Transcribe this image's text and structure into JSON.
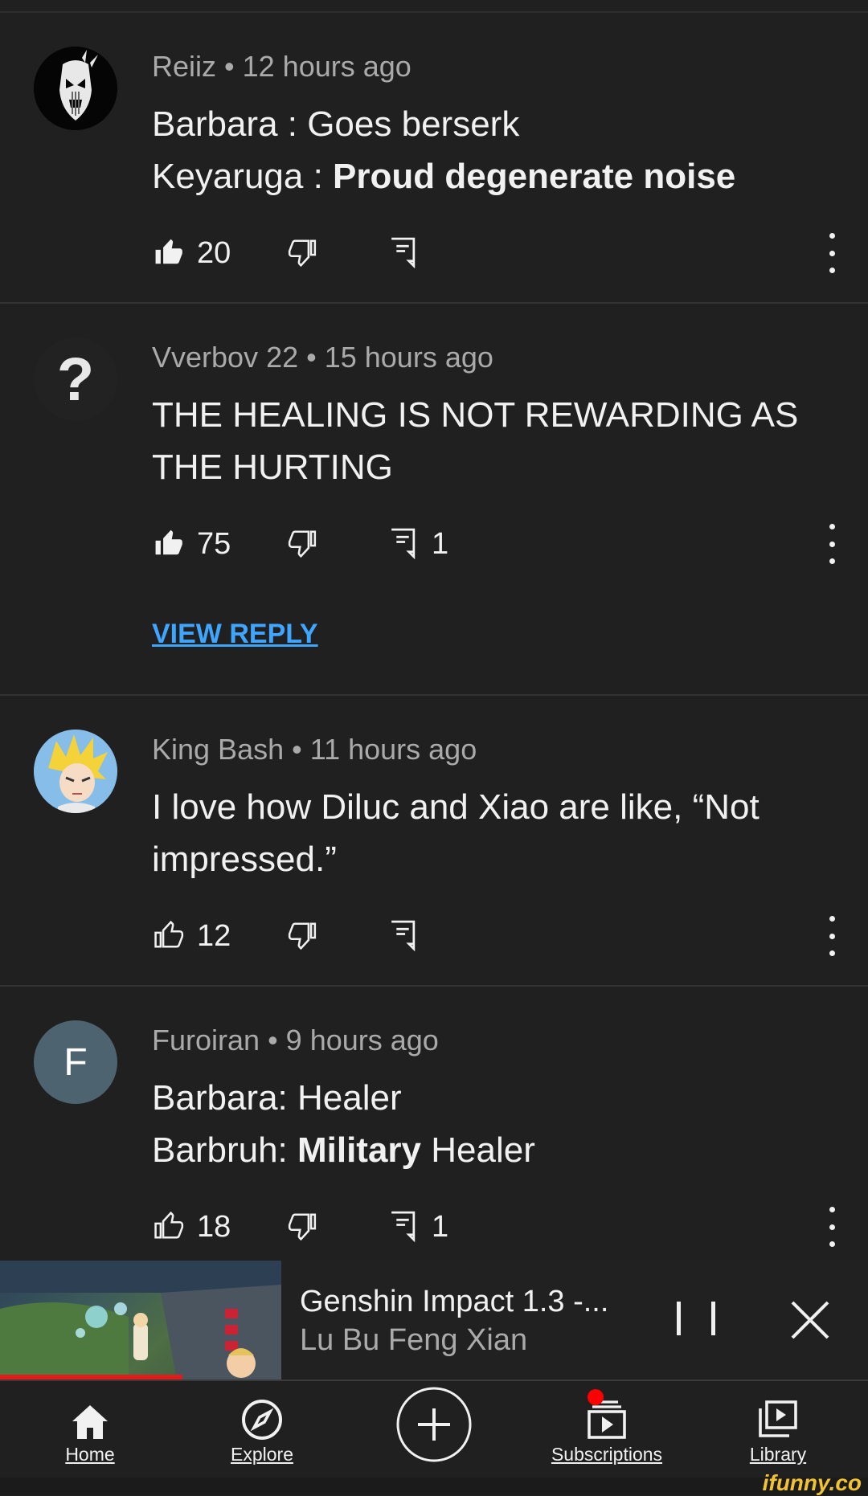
{
  "comments": [
    {
      "author": "Reiiz",
      "time": "12 hours ago",
      "lines": [
        {
          "normal": "Barbara : Goes berserk",
          "bold": "",
          "after": ""
        },
        {
          "normal": "Keyaruga : ",
          "bold": "Proud degenerate noise",
          "after": ""
        }
      ],
      "likes": "20",
      "replies": "",
      "liked": true,
      "avatar": "mask-avatar"
    },
    {
      "author": "Vverbov 22",
      "time": "15 hours ago",
      "text": "THE HEALING IS NOT REWARDING AS THE HURTING",
      "likes": "75",
      "replies": "1",
      "liked": true,
      "view_reply": "VIEW REPLY",
      "avatar_text": "?"
    },
    {
      "author": "King Bash",
      "time": "11 hours ago",
      "text": "I love how Diluc and Xiao are like, “Not impressed.”",
      "likes": "12",
      "replies": "",
      "liked": false,
      "avatar": "anime-character-avatar"
    },
    {
      "author": "Furoiran",
      "time": "9 hours ago",
      "lines": [
        {
          "normal": "Barbara: Healer",
          "bold": "",
          "after": ""
        },
        {
          "normal": "Barbruh: ",
          "bold": "Military",
          "after": " Healer"
        }
      ],
      "likes": "18",
      "replies": "1",
      "liked": false,
      "avatar_text": "F"
    }
  ],
  "separator": " • ",
  "miniplayer": {
    "title": "Genshin Impact 1.3 -...",
    "channel": "Lu Bu Feng Xian",
    "progress": 0.21
  },
  "nav": {
    "home": "Home",
    "explore": "Explore",
    "subscriptions": "Subscriptions",
    "library": "Library"
  },
  "watermark": "ifunny.co",
  "colors": {
    "background": "#202020",
    "link": "#3ea6ff",
    "progress": "#e21b1b",
    "notification": "#ff0000",
    "watermark": "#f2c230"
  }
}
